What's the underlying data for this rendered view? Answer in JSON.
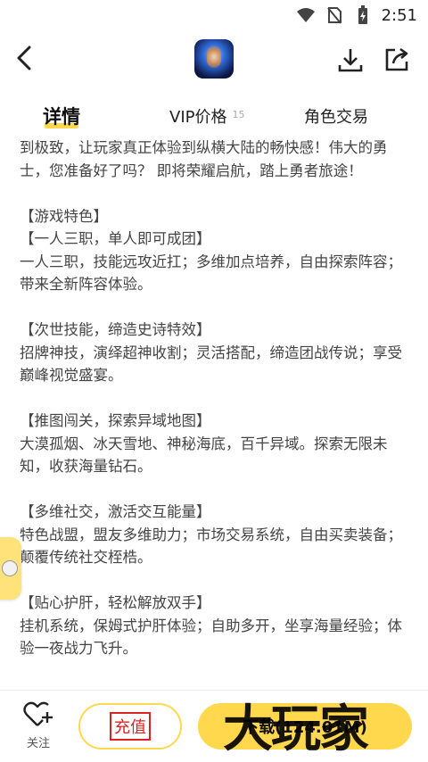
{
  "status_bar": {
    "time": "2:51",
    "icons": [
      "wifi-icon",
      "no-sim-icon",
      "battery-charging-icon"
    ]
  },
  "header": {
    "back_icon": "chevron-left-icon",
    "app_icon": "game-app-icon",
    "download_icon": "download-icon",
    "share_icon": "share-icon"
  },
  "tabs": [
    {
      "label": "详情",
      "active": true
    },
    {
      "label": "VIP价格",
      "count": "15"
    },
    {
      "label": "角色交易"
    }
  ],
  "content": {
    "intro": "到极致，让玩家真正体验到纵横大陆的畅快感！伟大的勇士，您准备好了吗？ 即将荣耀启航，踏上勇者旅途！",
    "section_title": "【游戏特色】",
    "features": [
      {
        "heading": "【一人三职，单人即可成团】",
        "body": "一人三职，技能远攻近扛；多维加点培养，自由探索阵容；带来全新阵容体验。"
      },
      {
        "heading": "【次世技能，缔造史诗特效】",
        "body": "招牌神技，演绎超神收割；灵活搭配，缔造团战传说；享受巅峰视觉盛宴。"
      },
      {
        "heading": "【推图闯关，探索异域地图】",
        "body": "大漠孤烟、冰天雪地、神秘海底，百千异域。探索无限未知，收获海量钻石。"
      },
      {
        "heading": "【多维社交，激活交互能量】",
        "body": "特色战盟，盟友多维助力；市场交易系统，自由买卖装备；颠覆传统社交桎梏。"
      },
      {
        "heading": "【贴心护肝，轻松解放双手】",
        "body": "挂机系统，保姆式护肝体验；自助多开，坐享海量经验；体验一夜战力飞升。"
      }
    ]
  },
  "bottom_bar": {
    "follow_label": "关注",
    "recharge_label": "充值",
    "download_label": "下载(124.01M)"
  },
  "watermark": "大玩家",
  "colors": {
    "accent": "#ffd84d",
    "highlight_red": "#dd2222"
  }
}
